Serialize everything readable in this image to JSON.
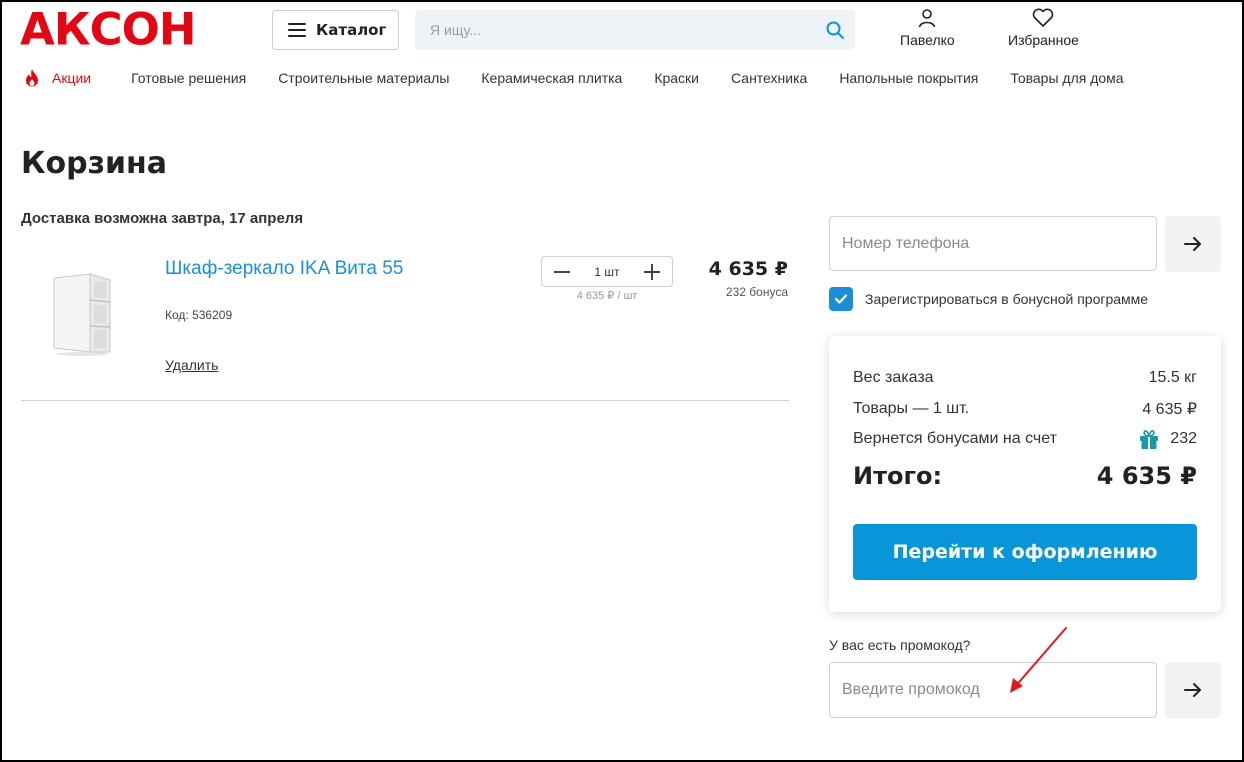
{
  "header": {
    "logo_text": "АКСОН",
    "catalog_label": "Каталог",
    "search_placeholder": "Я ищу...",
    "user_label": "Павелко",
    "favorites_label": "Избранное"
  },
  "nav": {
    "items": [
      {
        "label": "Акции",
        "icon": "fire-icon"
      },
      {
        "label": "Готовые решения"
      },
      {
        "label": "Строительные материалы"
      },
      {
        "label": "Керамическая плитка"
      },
      {
        "label": "Краски"
      },
      {
        "label": "Сантехника"
      },
      {
        "label": "Напольные покрытия"
      },
      {
        "label": "Товары для дома"
      }
    ]
  },
  "cart": {
    "title": "Корзина",
    "delivery_text": "Доставка возможна завтра, 17 апреля",
    "items": [
      {
        "name": "Шкаф-зеркало IKA Вита 55",
        "code": "Код: 536209",
        "quantity": "1 шт",
        "unit_price": "4 635 ₽ / шт",
        "price": "4 635 ₽",
        "bonus": "232 бонуса",
        "delete_label": "Удалить"
      }
    ]
  },
  "sidebar": {
    "phone_placeholder": "Номер телефона",
    "register_checkbox_label": "Зарегистрироваться в бонусной программе",
    "register_checked": true,
    "summary": {
      "weight_label": "Вес заказа",
      "weight_value": "15.5 кг",
      "goods_label": "Товары — 1 шт.",
      "goods_value": "4 635 ₽",
      "bonus_label": "Вернется бонусами на счет",
      "bonus_value": "232",
      "total_label": "Итого:",
      "total_value": "4 635 ₽",
      "checkout_label": "Перейти к оформлению"
    },
    "promo_question": "У вас есть промокод?",
    "promo_placeholder": "Введите промокод"
  },
  "colors": {
    "brand_red": "#e30613",
    "accent_blue": "#0996d9",
    "link_blue": "#1a8fd6",
    "gift_teal": "#1a9aa8",
    "annotation_red": "#e01b1b"
  }
}
